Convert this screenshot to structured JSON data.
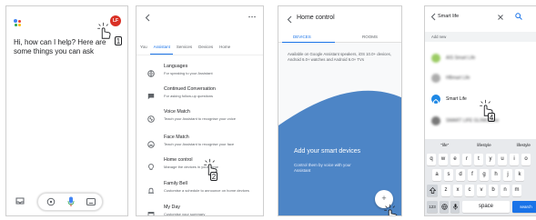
{
  "screen1": {
    "avatar": "LF",
    "greeting": "Hi, how can I help? Here are some things you can ask",
    "step": "1",
    "icons": [
      "assistant-logo-icon",
      "inbox-icon",
      "explore-icon",
      "mic-icon",
      "keyboard-icon"
    ]
  },
  "screen2": {
    "tabs": [
      "You",
      "Assistant",
      "Services",
      "Devices",
      "Home"
    ],
    "active_tab": "Assistant",
    "step": "2",
    "rows": [
      {
        "title": "Languages",
        "subtitle": "For speaking to your Assistant"
      },
      {
        "title": "Continued Conversation",
        "subtitle": "For asking follow-up questions"
      },
      {
        "title": "Voice Match",
        "subtitle": "Teach your Assistant to recognise your voice"
      },
      {
        "title": "Face Match",
        "subtitle": "Teach your Assistant to recognise your face"
      },
      {
        "title": "Home control",
        "subtitle": "Manage the devices in your home"
      },
      {
        "title": "Family Bell",
        "subtitle": "Customise a schedule to announce on home devices"
      },
      {
        "title": "My Day",
        "subtitle": "Customise your summary"
      }
    ]
  },
  "screen3": {
    "title": "Home control",
    "tabs": [
      "DEVICES",
      "ROOMS"
    ],
    "note": "Available on Google Assistant speakers, iOS 10.0+ devices, Android 6.0+ watches and Android 6.0+ TVs",
    "heading": "Add your smart devices",
    "sub": "Control them by voice with your Assistant",
    "fab": "+"
  },
  "screen4": {
    "query": "Smart life",
    "add_new": "Add new",
    "apps": [
      {
        "label": "AIS Smart Life",
        "color": "#8bc34a",
        "blurred": true
      },
      {
        "label": "HBmart Life",
        "color": "#9e9e9e",
        "blurred": true
      },
      {
        "label": "Smart Life",
        "color": "#1e88e5",
        "blurred": false
      },
      {
        "label": "SMART LIFE GLINK2ome",
        "color": "#616161",
        "blurred": true
      }
    ],
    "step": "4",
    "suggestions": [
      "\"life\"",
      "lifestyle",
      "lifestyle"
    ],
    "row1": [
      "q",
      "w",
      "e",
      "r",
      "t",
      "y",
      "u",
      "i",
      "o"
    ],
    "row2": [
      "a",
      "s",
      "d",
      "f",
      "g",
      "h",
      "j",
      "k"
    ],
    "row3": [
      "z",
      "x",
      "c",
      "v",
      "b",
      "n",
      "m"
    ],
    "bottom": {
      "num": "123",
      "space": "space",
      "search": "search"
    }
  }
}
